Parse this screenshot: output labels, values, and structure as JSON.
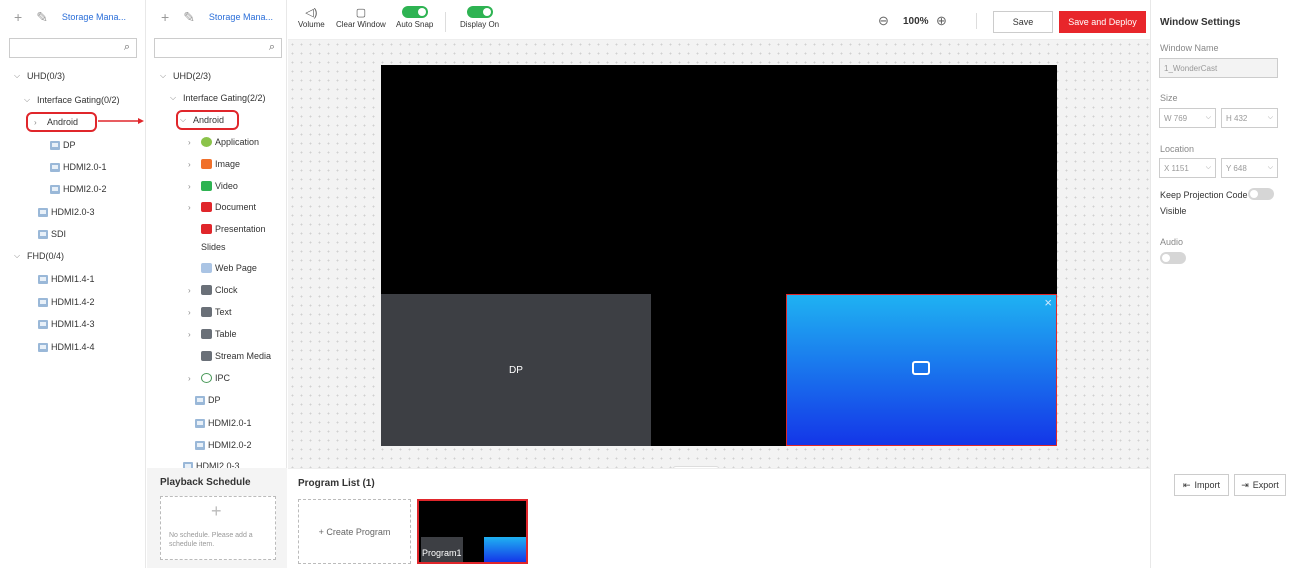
{
  "left_panel": {
    "title": "Storage Mana...",
    "search_placeholder": "",
    "tree": [
      {
        "label": "UHD(0/3)",
        "level": 0,
        "chev": "⌵"
      },
      {
        "label": "Interface Gating(0/2)",
        "level": 1
      },
      {
        "label": "Android",
        "level": 2
      },
      {
        "label": "DP",
        "level": 3
      },
      {
        "label": "HDMI2.0-1",
        "level": 3
      },
      {
        "label": "HDMI2.0-2",
        "level": 3
      },
      {
        "label": "HDMI2.0-3",
        "level": 2
      },
      {
        "label": "SDI",
        "level": 2
      },
      {
        "label": "FHD(0/4)",
        "level": 0
      },
      {
        "label": "HDMI1.4-1",
        "level": 2
      },
      {
        "label": "HDMI1.4-2",
        "level": 2
      },
      {
        "label": "HDMI1.4-3",
        "level": 2
      },
      {
        "label": "HDMI1.4-4",
        "level": 2
      }
    ]
  },
  "second_panel": {
    "title": "Storage Mana...",
    "tree": [
      {
        "label": "UHD(2/3)"
      },
      {
        "label": "Interface Gating(2/2)"
      },
      {
        "label": "Android"
      },
      {
        "label": "Application",
        "icon_color": "#8bc34a"
      },
      {
        "label": "Image",
        "icon_color": "#f0702a"
      },
      {
        "label": "Video",
        "icon_color": "#2eb352"
      },
      {
        "label": "Document",
        "icon_color": "#e0262b"
      },
      {
        "label": "Presentation"
      },
      {
        "label": "Slides"
      },
      {
        "label": "Web Page"
      },
      {
        "label": "Clock"
      },
      {
        "label": "Text"
      },
      {
        "label": "Table"
      },
      {
        "label": "Stream Media"
      },
      {
        "label": "IPC"
      },
      {
        "label": "DP"
      },
      {
        "label": "HDMI2.0-1"
      },
      {
        "label": "HDMI2.0-2"
      },
      {
        "label": "HDMI2.0-3"
      }
    ]
  },
  "toolbar": {
    "volume": "Volume",
    "clear_window": "Clear Window",
    "auto_snap": "Auto Snap",
    "display_on": "Display On",
    "zoom": "100%",
    "save": "Save",
    "save_deploy": "Save and Deploy"
  },
  "canvas": {
    "dp_label": "DP"
  },
  "settings": {
    "title": "Window Settings",
    "window_name_label": "Window Name",
    "window_name_value": "1_WonderCast",
    "size_label": "Size",
    "w_value": "W 769",
    "h_value": "H 432",
    "location_label": "Location",
    "x_value": "X 1151",
    "y_value": "Y 648",
    "keep_projection_label": "Keep Projection Code",
    "visible_label": "Visible",
    "audio_label": "Audio",
    "import": "Import",
    "export": "Export"
  },
  "schedule": {
    "title": "Playback Schedule",
    "empty_text": "No schedule. Please add a schedule item."
  },
  "program_list": {
    "title": "Program List  (1)",
    "create": "+ Create Program",
    "program_name": "Program1"
  },
  "colors": {
    "accent_red": "#e8262b",
    "toggle_on": "#2eb352"
  }
}
